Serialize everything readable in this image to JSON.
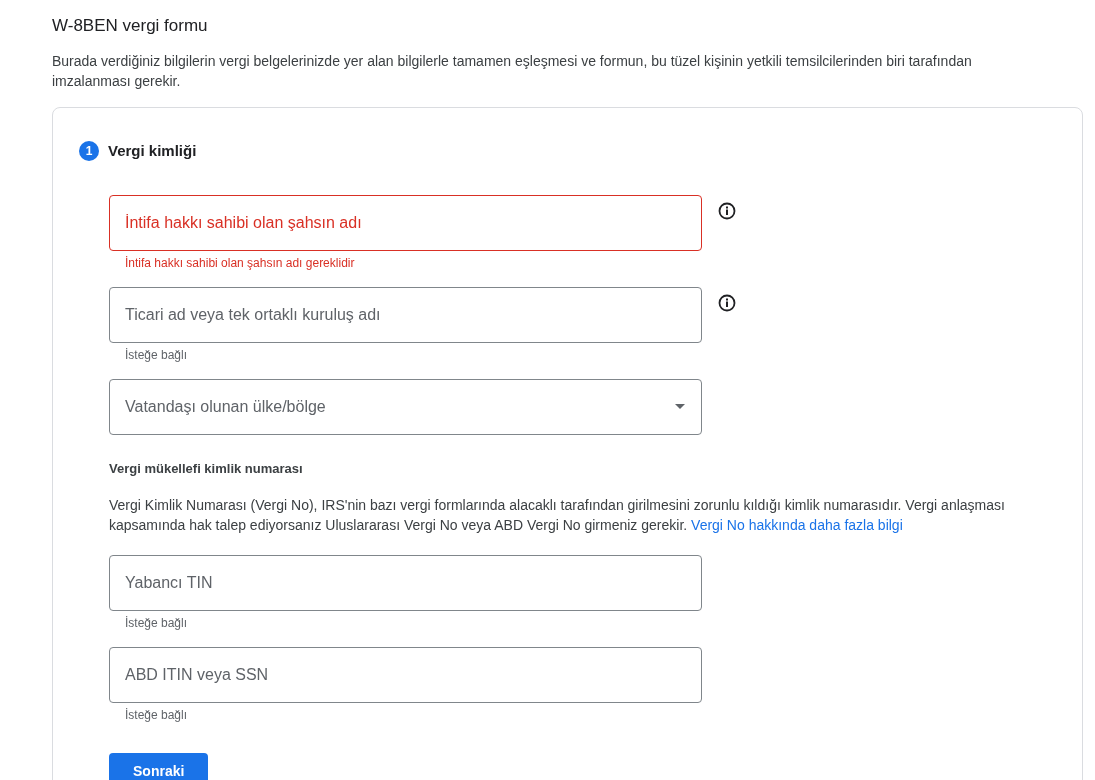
{
  "page": {
    "title": "W-8BEN vergi formu",
    "description": "Burada verdiğiniz bilgilerin vergi belgelerinizde yer alan bilgilerle tamamen eşleşmesi ve formun, bu tüzel kişinin yetkili temsilcilerinden biri tarafından imzalanması gerekir."
  },
  "step": {
    "number": "1",
    "title": "Vergi kimliği"
  },
  "fields_top": [
    {
      "kind": "text",
      "placeholder": "İntifa hakkı sahibi olan şahsın adı",
      "error": true,
      "helper": "İntifa hakkı sahibi olan şahsın adı gereklidir",
      "info": true
    },
    {
      "kind": "text",
      "placeholder": "Ticari ad veya tek ortaklı kuruluş adı",
      "error": false,
      "helper": "İsteğe bağlı",
      "info": true
    },
    {
      "kind": "select",
      "placeholder": "Vatandaşı olunan ülke/bölge",
      "error": false,
      "info": false
    }
  ],
  "tin_section": {
    "heading": "Vergi mükellefi kimlik numarası",
    "text": "Vergi Kimlik Numarası (Vergi No), IRS'nin bazı vergi formlarında alacaklı tarafından girilmesini zorunlu kıldığı kimlik numarasıdır. Vergi anlaşması kapsamında hak talep ediyorsanız Uluslararası Vergi No veya ABD Vergi No girmeniz gerekir.",
    "link": "Vergi No hakkında daha fazla bilgi"
  },
  "fields_bottom": [
    {
      "kind": "text",
      "placeholder": "Yabancı TIN",
      "error": false,
      "helper": "İsteğe bağlı",
      "info": false
    },
    {
      "kind": "text",
      "placeholder": "ABD ITIN veya SSN",
      "error": false,
      "helper": "İsteğe bağlı",
      "info": false
    }
  ],
  "next_button": "Sonraki"
}
